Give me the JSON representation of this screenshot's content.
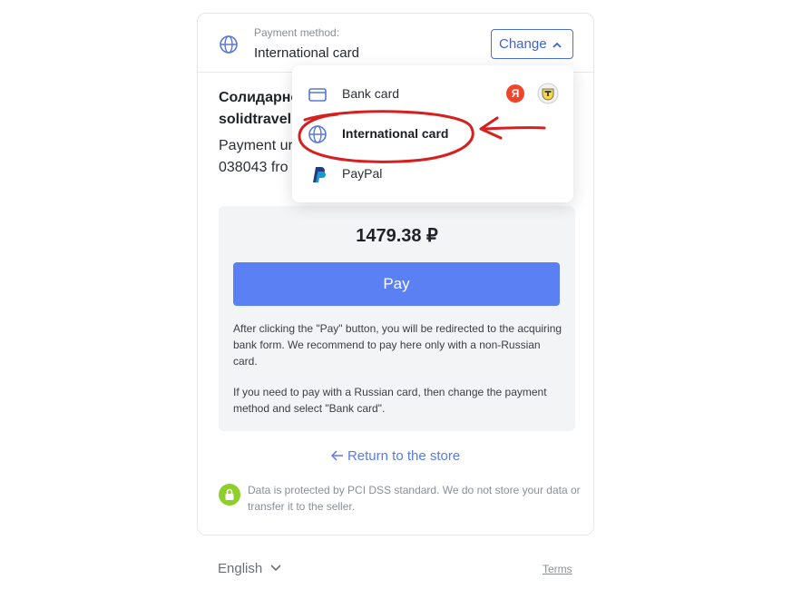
{
  "header": {
    "caption": "Payment method:",
    "value": "International card",
    "change_label": "Change",
    "globe_icon": "globe-icon"
  },
  "merchant": {
    "name": "Солидарность",
    "site": "solidtravel",
    "desc_line1": "Payment ur",
    "desc_line2": "038043 fro"
  },
  "payment": {
    "amount": "1479.38 ₽",
    "pay_label": "Pay",
    "notice1": "After clicking the \"Pay\" button, you will be redirected to the acquiring bank form. We recommend to pay here only with a non-Russian card.",
    "notice2": "If you need to pay with a Russian card, then change the payment method and select \"Bank card\"."
  },
  "return_label": "Return to the store",
  "security_text": "Data is protected by PCI DSS standard. We do not store your data or transfer it to the seller.",
  "footer": {
    "language": "English",
    "terms": "Terms"
  },
  "dropdown": {
    "options": [
      {
        "label": "Bank card",
        "icon": "bank-card-icon",
        "badges": [
          "Я"
        ]
      },
      {
        "label": "International card",
        "icon": "globe-icon",
        "selected": true
      },
      {
        "label": "PayPal",
        "icon": "paypal-icon"
      }
    ]
  },
  "colors": {
    "accent": "#5b80f3",
    "link": "#5a7ae8",
    "security": "#8fcf2a",
    "annotation": "#d6201f"
  }
}
